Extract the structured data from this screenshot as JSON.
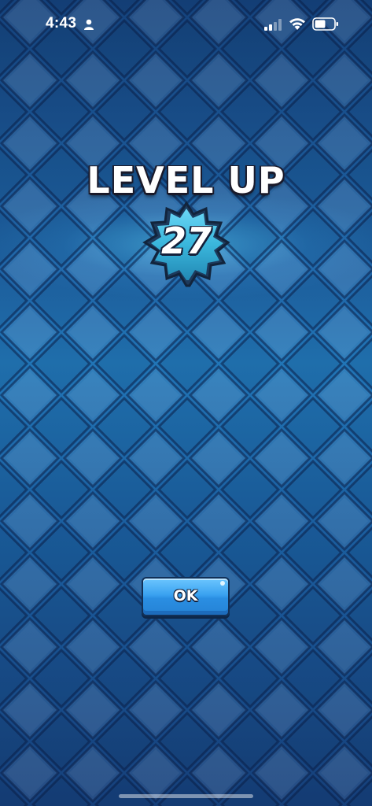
{
  "status_bar": {
    "time": "4:43",
    "person_icon": "person-icon",
    "signal_icon": "cellular-signal-icon",
    "wifi_icon": "wifi-icon",
    "battery_icon": "battery-icon"
  },
  "level_up": {
    "title": "LEVEL UP",
    "level": "27",
    "badge_icon": "level-star-badge-icon"
  },
  "actions": {
    "ok_label": "OK"
  },
  "colors": {
    "background": "#1b4f8c",
    "tile_light": "#2a78ba",
    "tile_dark": "#14427c",
    "button": "#3aa2f0",
    "badge": "#3ab6dc"
  }
}
